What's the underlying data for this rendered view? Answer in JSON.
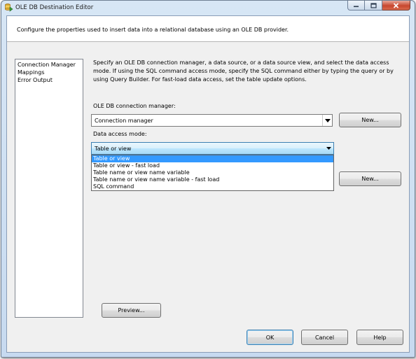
{
  "window": {
    "title": "OLE DB Destination Editor",
    "header_description": "Configure the properties used to insert data into a relational database using an OLE DB provider."
  },
  "nav": {
    "items": [
      {
        "label": "Connection Manager"
      },
      {
        "label": "Mappings"
      },
      {
        "label": "Error Output"
      }
    ]
  },
  "main": {
    "description": "Specify an OLE DB connection manager, a data source, or a data source view, and select the data access mode. If using the SQL command access mode, specify the SQL command either by typing the query or by using Query Builder. For fast-load data access, set the table update options.",
    "connection_label": "OLE DB connection manager:",
    "connection_value": "Connection manager",
    "access_mode_label": "Data access mode:",
    "access_mode_value": "Table or view",
    "new_button_1": "New...",
    "new_button_2": "New...",
    "preview_button": "Preview...",
    "access_mode_options": [
      {
        "label": "Table or view",
        "selected": true
      },
      {
        "label": "Table or view - fast load",
        "selected": false
      },
      {
        "label": "Table name or view name variable",
        "selected": false
      },
      {
        "label": "Table name or view name variable - fast load",
        "selected": false
      },
      {
        "label": "SQL command",
        "selected": false
      }
    ]
  },
  "footer": {
    "ok": "OK",
    "cancel": "Cancel",
    "help": "Help"
  },
  "icons": {
    "app": "ole-db-destination-icon",
    "minimize": "minimize-icon",
    "maximize": "maximize-icon",
    "close": "close-icon",
    "dropdown": "chevron-down-icon"
  },
  "colors": {
    "selection": "#3399ff",
    "titlebar": "#c7daf0",
    "close_button": "#c7472f",
    "dialog_body": "#f0f0f0"
  }
}
